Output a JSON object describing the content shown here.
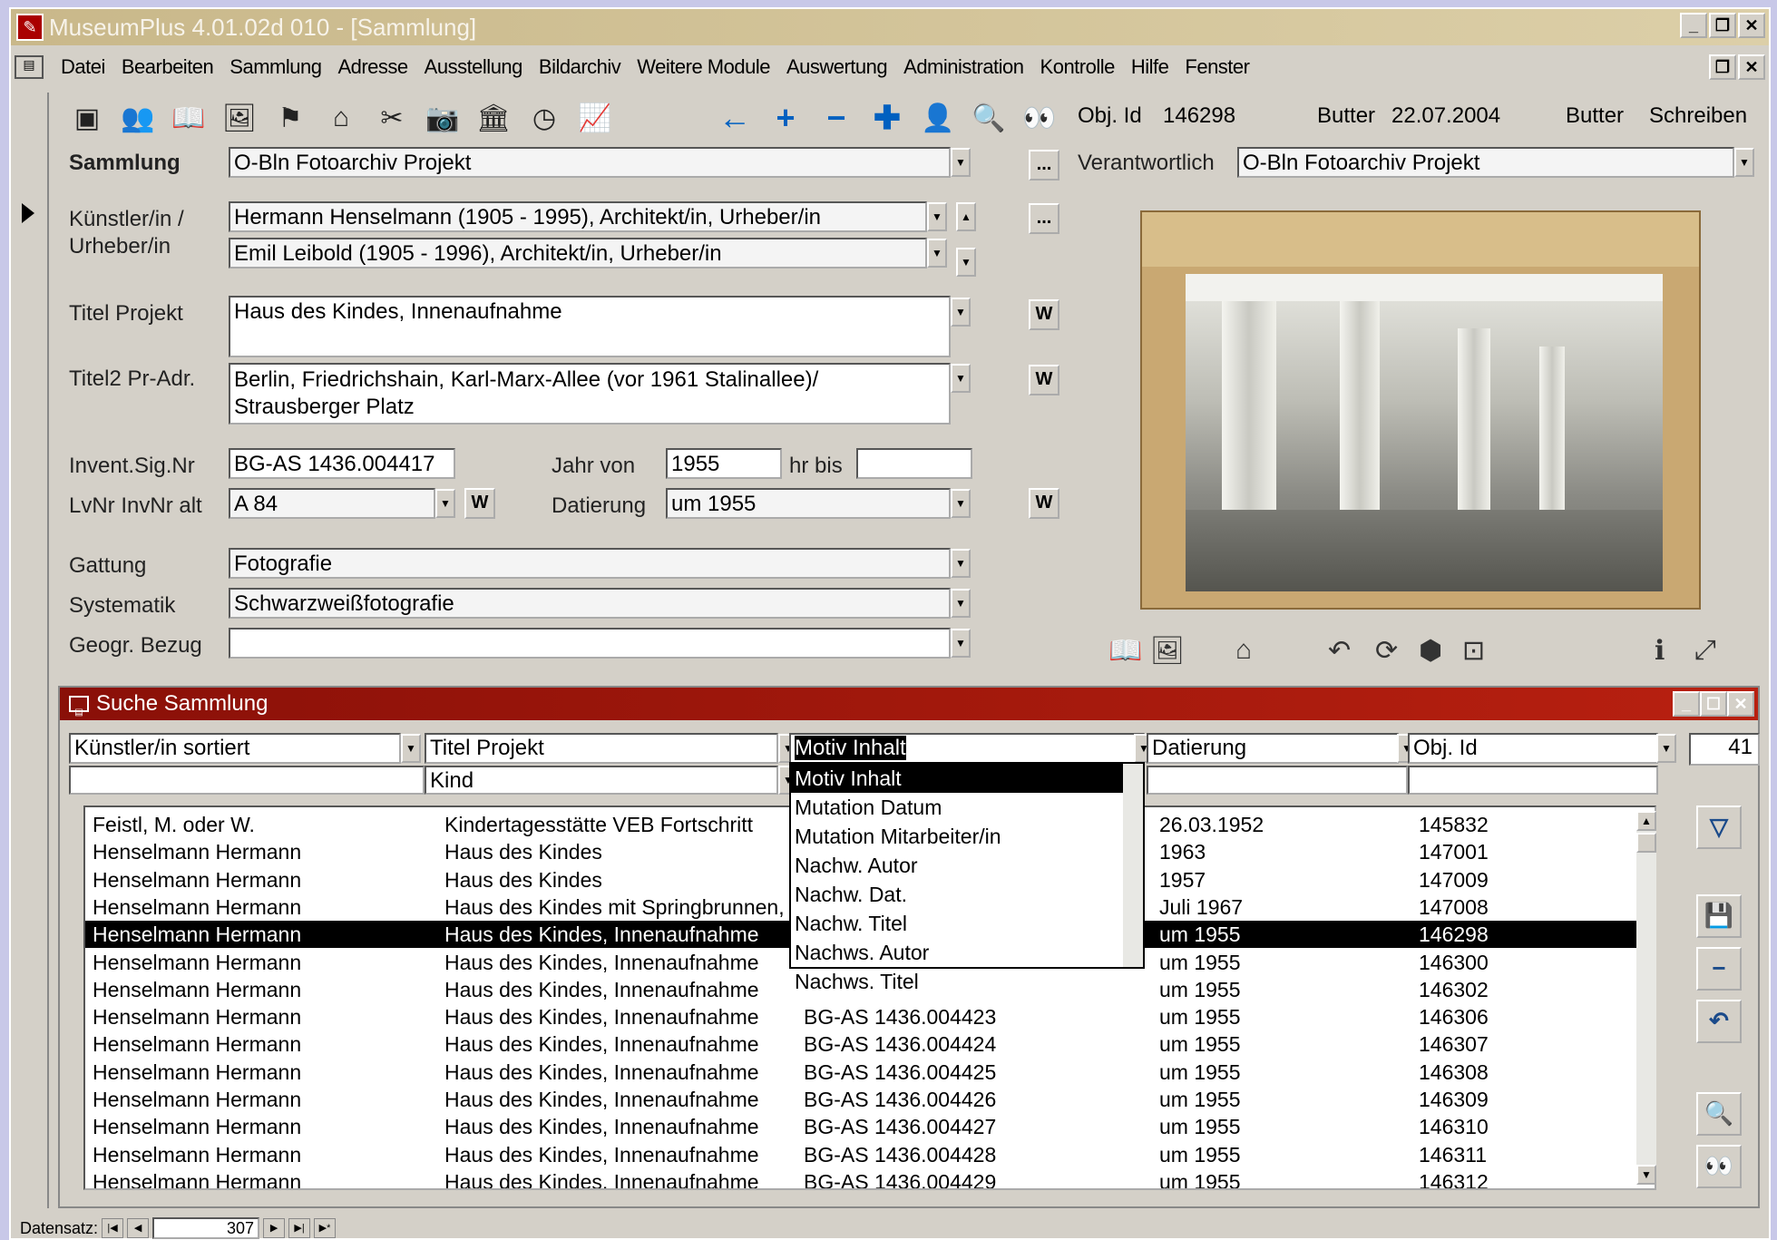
{
  "window": {
    "title": "MuseumPlus 4.01.02d 010 - [Sammlung]"
  },
  "menu": [
    "Datei",
    "Bearbeiten",
    "Sammlung",
    "Adresse",
    "Ausstellung",
    "Bildarchiv",
    "Weitere Module",
    "Auswertung",
    "Administration",
    "Kontrolle",
    "Hilfe",
    "Fenster"
  ],
  "header": {
    "obj_id_label": "Obj. Id",
    "obj_id_value": "146298",
    "user": "Butter",
    "date": "22.07.2004",
    "user2": "Butter",
    "mode": "Schreiben"
  },
  "form": {
    "sammlung_label": "Sammlung",
    "sammlung_value": "O-Bln Fotoarchiv Projekt",
    "verantwortlich_label": "Verantwortlich",
    "verantwortlich_value": "O-Bln Fotoarchiv Projekt",
    "kuenstler_label_1": "Künstler/in /",
    "kuenstler_label_2": "Urheber/in",
    "kuenstler_1": "Hermann Henselmann (1905 - 1995), Architekt/in, Urheber/in",
    "kuenstler_2": "Emil Leibold (1905 - 1996), Architekt/in, Urheber/in",
    "titel_label": "Titel Projekt",
    "titel_value": "Haus des Kindes, Innenaufnahme",
    "titel2_label": "Titel2 Pr-Adr.",
    "titel2_line1": "Berlin, Friedrichshain, Karl-Marx-Allee (vor 1961 Stalinallee)/",
    "titel2_line2": "Strausberger Platz",
    "invent_label": "Invent.Sig.Nr",
    "invent_value": "BG-AS 1436.004417",
    "jahr_von_label": "Jahr von",
    "jahr_von_value": "1955",
    "jahr_bis_label": "hr bis",
    "jahr_bis_value": "",
    "lvnr_label": "LvNr InvNr alt",
    "lvnr_value": "A 84",
    "datierung_label": "Datierung",
    "datierung_value": "um 1955",
    "gattung_label": "Gattung",
    "gattung_value": "Fotografie",
    "systematik_label": "Systematik",
    "systematik_value": "Schwarzweißfotografie",
    "geogr_label": "Geogr. Bezug",
    "geogr_value": "",
    "ellipsis": "...",
    "w_button": "W"
  },
  "search_window": {
    "title": "Suche Sammlung",
    "columns": [
      "Künstler/in sortiert",
      "Titel Projekt",
      "Motiv Inhalt",
      "Datierung",
      "Obj. Id"
    ],
    "second_header": "Kind",
    "count": "41",
    "dropdown_items": [
      "Motiv Inhalt",
      "Mutation Datum",
      "Mutation Mitarbeiter/in",
      "Nachw. Autor",
      "Nachw. Dat.",
      "Nachw. Titel",
      "Nachws. Autor",
      "Nachws. Titel"
    ],
    "rows": [
      {
        "artist": "Feistl, M. oder W.",
        "title": "Kindertagesstätte VEB Fortschritt",
        "motif": "",
        "date": "26.03.1952",
        "id": "145832"
      },
      {
        "artist": "Henselmann Hermann",
        "title": "Haus des Kindes",
        "motif": "",
        "date": "1963",
        "id": "147001"
      },
      {
        "artist": "Henselmann Hermann",
        "title": "Haus des Kindes",
        "motif": "",
        "date": "1957",
        "id": "147009"
      },
      {
        "artist": "Henselmann Hermann",
        "title": "Haus des Kindes mit Springbrunnen,",
        "motif": "",
        "date": "Juli 1967",
        "id": "147008"
      },
      {
        "artist": "Henselmann Hermann",
        "title": "Haus des Kindes, Innenaufnahme",
        "motif": "",
        "date": "um 1955",
        "id": "146298"
      },
      {
        "artist": "Henselmann Hermann",
        "title": "Haus des Kindes, Innenaufnahme",
        "motif": "",
        "date": "um 1955",
        "id": "146300"
      },
      {
        "artist": "Henselmann Hermann",
        "title": "Haus des Kindes, Innenaufnahme",
        "motif": "",
        "date": "um 1955",
        "id": "146302"
      },
      {
        "artist": "Henselmann Hermann",
        "title": "Haus des Kindes, Innenaufnahme",
        "motif": "BG-AS 1436.004423",
        "date": "um 1955",
        "id": "146306"
      },
      {
        "artist": "Henselmann Hermann",
        "title": "Haus des Kindes, Innenaufnahme",
        "motif": "BG-AS 1436.004424",
        "date": "um 1955",
        "id": "146307"
      },
      {
        "artist": "Henselmann Hermann",
        "title": "Haus des Kindes, Innenaufnahme",
        "motif": "BG-AS 1436.004425",
        "date": "um 1955",
        "id": "146308"
      },
      {
        "artist": "Henselmann Hermann",
        "title": "Haus des Kindes, Innenaufnahme",
        "motif": "BG-AS 1436.004426",
        "date": "um 1955",
        "id": "146309"
      },
      {
        "artist": "Henselmann Hermann",
        "title": "Haus des Kindes, Innenaufnahme",
        "motif": "BG-AS 1436.004427",
        "date": "um 1955",
        "id": "146310"
      },
      {
        "artist": "Henselmann Hermann",
        "title": "Haus des Kindes, Innenaufnahme",
        "motif": "BG-AS 1436.004428",
        "date": "um 1955",
        "id": "146311"
      },
      {
        "artist": "Henselmann Hermann",
        "title": "Haus des Kindes, Innenaufnahme",
        "motif": "BG-AS 1436.004429",
        "date": "um 1955",
        "id": "146312"
      }
    ],
    "selected_row": 4
  },
  "statusbar": {
    "label": "Datensatz:",
    "record": "307"
  }
}
